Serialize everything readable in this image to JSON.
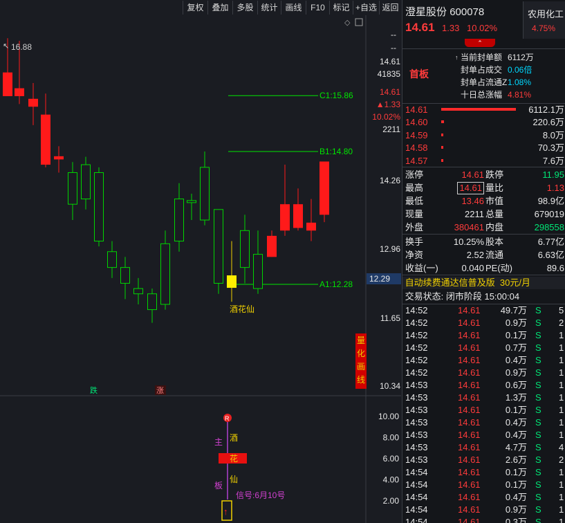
{
  "toolbar": {
    "items": [
      "复权",
      "叠加",
      "多股",
      "统计",
      "画线",
      "F10",
      "标记",
      "+自选",
      "返回"
    ]
  },
  "stock": {
    "name": "澄星股份",
    "code": "600078",
    "price": "14.61",
    "change": "1.33",
    "pct": "10.02%",
    "sector": "农用化工",
    "sector_pct": "4.75%"
  },
  "limit": {
    "tag": "首板",
    "rows": [
      {
        "label": "当前封单额",
        "value": "6112万",
        "color": "white"
      },
      {
        "label": "封单占成交",
        "value": "0.06倍",
        "color": "cyan"
      },
      {
        "label": "封单占流通Z",
        "value": "1.08%",
        "color": "cyan"
      },
      {
        "label": "十日总涨幅",
        "value": "4.81%",
        "color": "red"
      }
    ]
  },
  "orderbook": [
    {
      "price": "14.61",
      "vol": "6112.1万",
      "bar": 1.0
    },
    {
      "price": "14.60",
      "vol": "220.6万",
      "bar": 0.036
    },
    {
      "price": "14.59",
      "vol": "8.0万",
      "bar": 0.0013
    },
    {
      "price": "14.58",
      "vol": "70.3万",
      "bar": 0.0115
    },
    {
      "price": "14.57",
      "vol": "7.6万",
      "bar": 0.0012
    }
  ],
  "quote": [
    {
      "l1": "涨停",
      "v1": "14.61",
      "c1": "red",
      "l2": "跌停",
      "v2": "11.95",
      "c2": "green"
    },
    {
      "l1": "最高",
      "v1": "14.61",
      "c1": "red",
      "boxed": true,
      "l2": "量比",
      "v2": "1.13",
      "c2": "red"
    },
    {
      "l1": "最低",
      "v1": "13.46",
      "c1": "red",
      "l2": "市值",
      "v2": "98.9亿",
      "c2": "white"
    },
    {
      "l1": "现量",
      "v1": "2211",
      "c1": "white",
      "l2": "总量",
      "v2": "679019",
      "c2": "white"
    },
    {
      "l1": "外盘",
      "v1": "380461",
      "c1": "red",
      "l2": "内盘",
      "v2": "298558",
      "c2": "green"
    }
  ],
  "quote2": [
    {
      "l1": "换手",
      "v1": "10.25%",
      "l2": "股本",
      "v2": "6.77亿"
    },
    {
      "l1": "净资",
      "v1": "2.52",
      "l2": "流通",
      "v2": "6.63亿"
    },
    {
      "l1": "收益(一)",
      "v1": "0.040",
      "l2": "PE(动)",
      "v2": "89.6"
    }
  ],
  "promo": {
    "text": "自动续费通达信普及版",
    "price": "30元/月"
  },
  "status": {
    "text": "交易状态: 闭市阶段 15:00:04"
  },
  "ticks": [
    {
      "t": "14:52",
      "p": "14.61",
      "v": "49.7万",
      "s": "S",
      "n": "5"
    },
    {
      "t": "14:52",
      "p": "14.61",
      "v": "0.9万",
      "s": "S",
      "n": "2"
    },
    {
      "t": "14:52",
      "p": "14.61",
      "v": "0.1万",
      "s": "S",
      "n": "1"
    },
    {
      "t": "14:52",
      "p": "14.61",
      "v": "0.7万",
      "s": "S",
      "n": "1"
    },
    {
      "t": "14:52",
      "p": "14.61",
      "v": "0.4万",
      "s": "S",
      "n": "1"
    },
    {
      "t": "14:52",
      "p": "14.61",
      "v": "0.9万",
      "s": "S",
      "n": "1"
    },
    {
      "t": "14:53",
      "p": "14.61",
      "v": "0.6万",
      "s": "S",
      "n": "1"
    },
    {
      "t": "14:53",
      "p": "14.61",
      "v": "1.3万",
      "s": "S",
      "n": "1"
    },
    {
      "t": "14:53",
      "p": "14.61",
      "v": "0.1万",
      "s": "S",
      "n": "1"
    },
    {
      "t": "14:53",
      "p": "14.61",
      "v": "0.4万",
      "s": "S",
      "n": "1"
    },
    {
      "t": "14:53",
      "p": "14.61",
      "v": "0.4万",
      "s": "S",
      "n": "1"
    },
    {
      "t": "14:53",
      "p": "14.61",
      "v": "4.7万",
      "s": "S",
      "n": "4"
    },
    {
      "t": "14:53",
      "p": "14.61",
      "v": "2.6万",
      "s": "S",
      "n": "2"
    },
    {
      "t": "14:54",
      "p": "14.61",
      "v": "0.1万",
      "s": "S",
      "n": "1"
    },
    {
      "t": "14:54",
      "p": "14.61",
      "v": "0.1万",
      "s": "S",
      "n": "1"
    },
    {
      "t": "14:54",
      "p": "14.61",
      "v": "0.4万",
      "s": "S",
      "n": "1"
    },
    {
      "t": "14:54",
      "p": "14.61",
      "v": "0.9万",
      "s": "S",
      "n": "1"
    },
    {
      "t": "14:54",
      "p": "14.61",
      "v": "0.3万",
      "s": "S",
      "n": "1"
    }
  ],
  "chart": {
    "high_label": "16.88",
    "price_axis": [
      "14.61",
      "41835",
      "14.61",
      "▲1.33",
      "10.02%",
      "2211",
      "14.26",
      "12.96",
      "12.29",
      "11.65",
      "10.34"
    ],
    "levels": [
      {
        "label": "C1:15.86",
        "price": 15.86
      },
      {
        "label": "B1:14.80",
        "price": 14.8
      },
      {
        "label": "A1:12.28",
        "price": 12.28
      }
    ],
    "signal_label": "酒花仙",
    "side_tag": "量化画线",
    "markers": [
      "跌",
      "涨"
    ],
    "candles": [
      {
        "o": 16.3,
        "h": 16.95,
        "l": 15.9,
        "c": 15.85
      },
      {
        "o": 16.0,
        "h": 16.9,
        "l": 15.7,
        "c": 15.85
      },
      {
        "o": 15.8,
        "h": 16.1,
        "l": 15.3,
        "c": 15.65
      },
      {
        "o": 15.5,
        "h": 15.9,
        "l": 14.5,
        "c": 14.55
      },
      {
        "o": 14.71,
        "h": 14.9,
        "l": 14.4,
        "c": 14.65
      },
      {
        "o": 13.8,
        "h": 14.6,
        "l": 13.5,
        "c": 14.4
      },
      {
        "o": 13.9,
        "h": 14.7,
        "l": 13.7,
        "c": 14.55
      },
      {
        "o": 13.1,
        "h": 14.5,
        "l": 13.0,
        "c": 14.4
      },
      {
        "o": 12.6,
        "h": 13.1,
        "l": 12.4,
        "c": 12.9
      },
      {
        "o": 12.3,
        "h": 12.8,
        "l": 12.0,
        "c": 12.6
      },
      {
        "o": 12.1,
        "h": 12.4,
        "l": 11.9,
        "c": 12.2
      },
      {
        "o": 11.8,
        "h": 12.2,
        "l": 11.55,
        "c": 12.1
      },
      {
        "o": 11.9,
        "h": 13.3,
        "l": 11.8,
        "c": 13.05
      },
      {
        "o": 13.1,
        "h": 14.2,
        "l": 12.9,
        "c": 13.9
      },
      {
        "o": 13.83,
        "h": 14.0,
        "l": 13.5,
        "c": 13.87
      },
      {
        "o": 13.5,
        "h": 14.8,
        "l": 13.4,
        "c": 14.5
      },
      {
        "o": 12.3,
        "h": 13.7,
        "l": 12.1,
        "c": 13.7
      },
      {
        "o": 12.3,
        "h": 13.1,
        "l": 11.95,
        "c": 12.45,
        "yellow": true
      },
      {
        "o": 12.6,
        "h": 13.6,
        "l": 12.3,
        "c": 13.3
      },
      {
        "o": 12.2,
        "h": 13.3,
        "l": 12.1,
        "c": 12.85
      },
      {
        "o": 13.2,
        "h": 13.3,
        "l": 12.8,
        "c": 12.8,
        "red": true
      },
      {
        "o": 13.3,
        "h": 14.55,
        "l": 13.2,
        "c": 13.8,
        "red": true
      },
      {
        "o": 13.8,
        "h": 14.1,
        "l": 13.3,
        "c": 13.35,
        "red": true
      },
      {
        "o": 13.45,
        "h": 13.9,
        "l": 13.1,
        "c": 13.3,
        "red": true
      },
      {
        "o": 14.61,
        "h": 14.61,
        "l": 13.46,
        "c": 13.6,
        "red": true
      }
    ],
    "ind_axis": [
      "10.00",
      "8.00",
      "6.00",
      "4.00",
      "2.00"
    ],
    "ind_labels": {
      "main": "主",
      "board": "板",
      "jiu": "酒",
      "hua": "花",
      "xian": "仙",
      "signal": "信号:6月10号"
    }
  }
}
